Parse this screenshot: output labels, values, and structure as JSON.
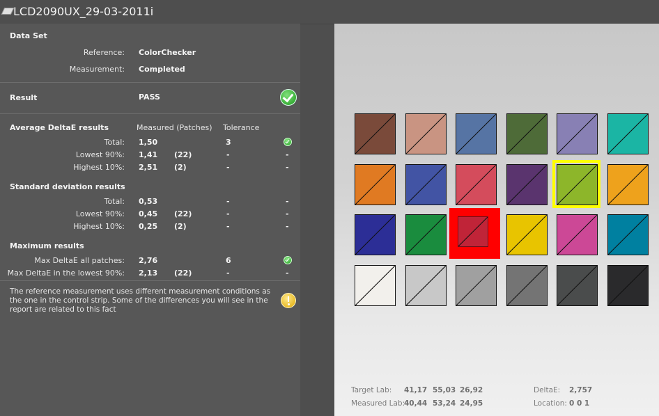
{
  "window": {
    "title": "LCD2090UX_29-03-2011i"
  },
  "dataset": {
    "heading": "Data Set",
    "reference_label": "Reference:",
    "reference_value": "ColorChecker",
    "measurement_label": "Measurement:",
    "measurement_value": "Completed"
  },
  "result": {
    "label": "Result",
    "value": "PASS"
  },
  "average": {
    "heading": "Average DeltaE results",
    "col_measured": "Measured (Patches)",
    "col_tolerance": "Tolerance",
    "rows": [
      {
        "label": "Total:",
        "value": "1,50",
        "patches": "",
        "tolerance": "3",
        "status": ""
      },
      {
        "label": "Lowest 90%:",
        "value": "1,41",
        "patches": "(22)",
        "tolerance": "-",
        "status": "-"
      },
      {
        "label": "Highest 10%:",
        "value": "2,51",
        "patches": "(2)",
        "tolerance": "-",
        "status": "-"
      }
    ]
  },
  "stddev": {
    "heading": "Standard deviation results",
    "rows": [
      {
        "label": "Total:",
        "value": "0,53",
        "patches": "",
        "tolerance": "-",
        "status": "-"
      },
      {
        "label": "Lowest 90%:",
        "value": "0,45",
        "patches": "(22)",
        "tolerance": "-",
        "status": "-"
      },
      {
        "label": "Highest 10%:",
        "value": "0,25",
        "patches": "(2)",
        "tolerance": "-",
        "status": "-"
      }
    ]
  },
  "maximum": {
    "heading": "Maximum results",
    "rows": [
      {
        "label": "Max DeltaE all patches:",
        "value": "2,76",
        "patches": "",
        "tolerance": "6",
        "status": ""
      },
      {
        "label": "Max DeltaE in the lowest 90%:",
        "value": "2,13",
        "patches": "(22)",
        "tolerance": "-",
        "status": "-"
      }
    ]
  },
  "note": "The reference measurement uses different measurement conditions as the one in the control strip. Some of the differences you will see in the report are related to this fact",
  "patches": [
    [
      "#7a4a3a",
      "#c99482",
      "#5674a4",
      "#4e6b38",
      "#8880b4",
      "#1bb5a4"
    ],
    [
      "#e07a22",
      "#4254a4",
      "#d44c5c",
      "#5a346e",
      "#8db62a",
      "#eea21c"
    ],
    [
      "#2c2e96",
      "#1a8c3e",
      "#c02438",
      "#e8c400",
      "#cc4896",
      "#0080a0"
    ],
    [
      "#f2f0ec",
      "#c8c8c8",
      "#a0a0a0",
      "#747474",
      "#4a4c4c",
      "#2a2a2c"
    ]
  ],
  "stats": {
    "target_label": "Target Lab:",
    "target_l": "41,17",
    "target_a": "55,03",
    "target_b": "26,92",
    "measured_label": "Measured Lab:",
    "measured_l": "40,44",
    "measured_a": "53,24",
    "measured_b": "24,95",
    "deltae_label": "DeltaE:",
    "deltae_value": "2,757",
    "location_label": "Location:",
    "location_value": "0 0 1"
  }
}
